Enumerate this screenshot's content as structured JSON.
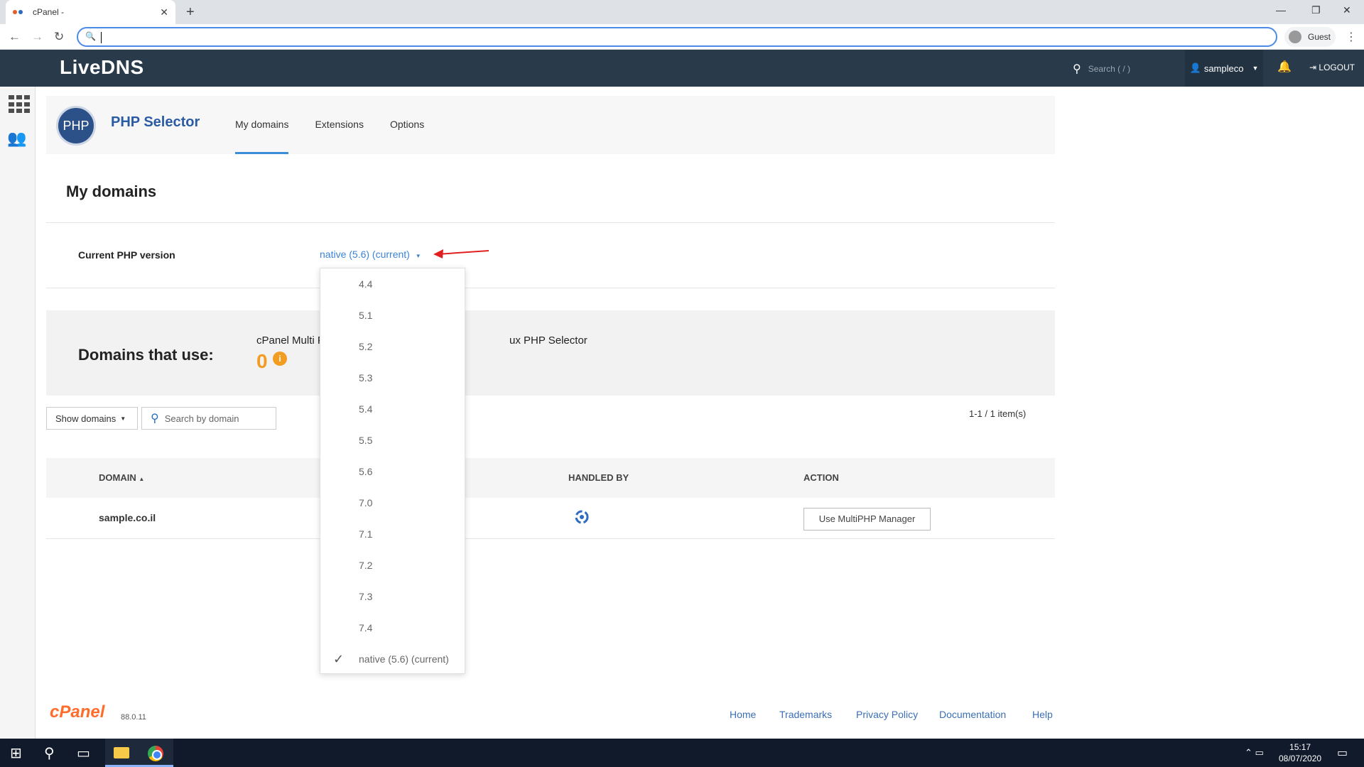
{
  "browser": {
    "tab_title": "cPanel -",
    "tab_close": "✕",
    "new_tab": "+",
    "guest_label": "Guest"
  },
  "header": {
    "logo": "LiveDNS",
    "search_placeholder": "Search ( / )",
    "username": "sampleco",
    "logout": "LOGOUT"
  },
  "app": {
    "title": "PHP Selector",
    "logo_text": "PHP",
    "tabs": [
      {
        "label": "My domains",
        "active": true
      },
      {
        "label": "Extensions",
        "active": false
      },
      {
        "label": "Options",
        "active": false
      }
    ]
  },
  "main": {
    "page_title": "My domains",
    "current_php_label": "Current PHP version",
    "current_php_value": "native (5.6) (current)",
    "domains_use_label": "Domains that use:",
    "domains_use_text1": "cPanel Multi P",
    "domains_use_text2": "ux PHP Selector",
    "domains_use_count": "0",
    "show_domains": "Show domains",
    "search_placeholder": "Search by domain",
    "items_count": "1-1 / 1 item(s)"
  },
  "table": {
    "headers": [
      "DOMAIN",
      "HANDLED BY",
      "ACTION"
    ],
    "sort_indicator": "▲",
    "rows": [
      {
        "domain": "sample.co.il",
        "action": "Use MultiPHP Manager"
      }
    ]
  },
  "dropdown": {
    "items": [
      "4.4",
      "5.1",
      "5.2",
      "5.3",
      "5.4",
      "5.5",
      "5.6",
      "7.0",
      "7.1",
      "7.2",
      "7.3",
      "7.4",
      "native (5.6) (current)"
    ],
    "selected_index": 12
  },
  "footer": {
    "logo": "cPanel",
    "version": "88.0.11",
    "links": [
      "Home",
      "Trademarks",
      "Privacy Policy",
      "Documentation",
      "Help"
    ]
  },
  "taskbar": {
    "time": "15:17",
    "date": "08/07/2020"
  },
  "colors": {
    "header_bg": "#293a4a",
    "accent_blue": "#3c83d6",
    "orange": "#f39c22",
    "arrow_red": "#e02020"
  }
}
